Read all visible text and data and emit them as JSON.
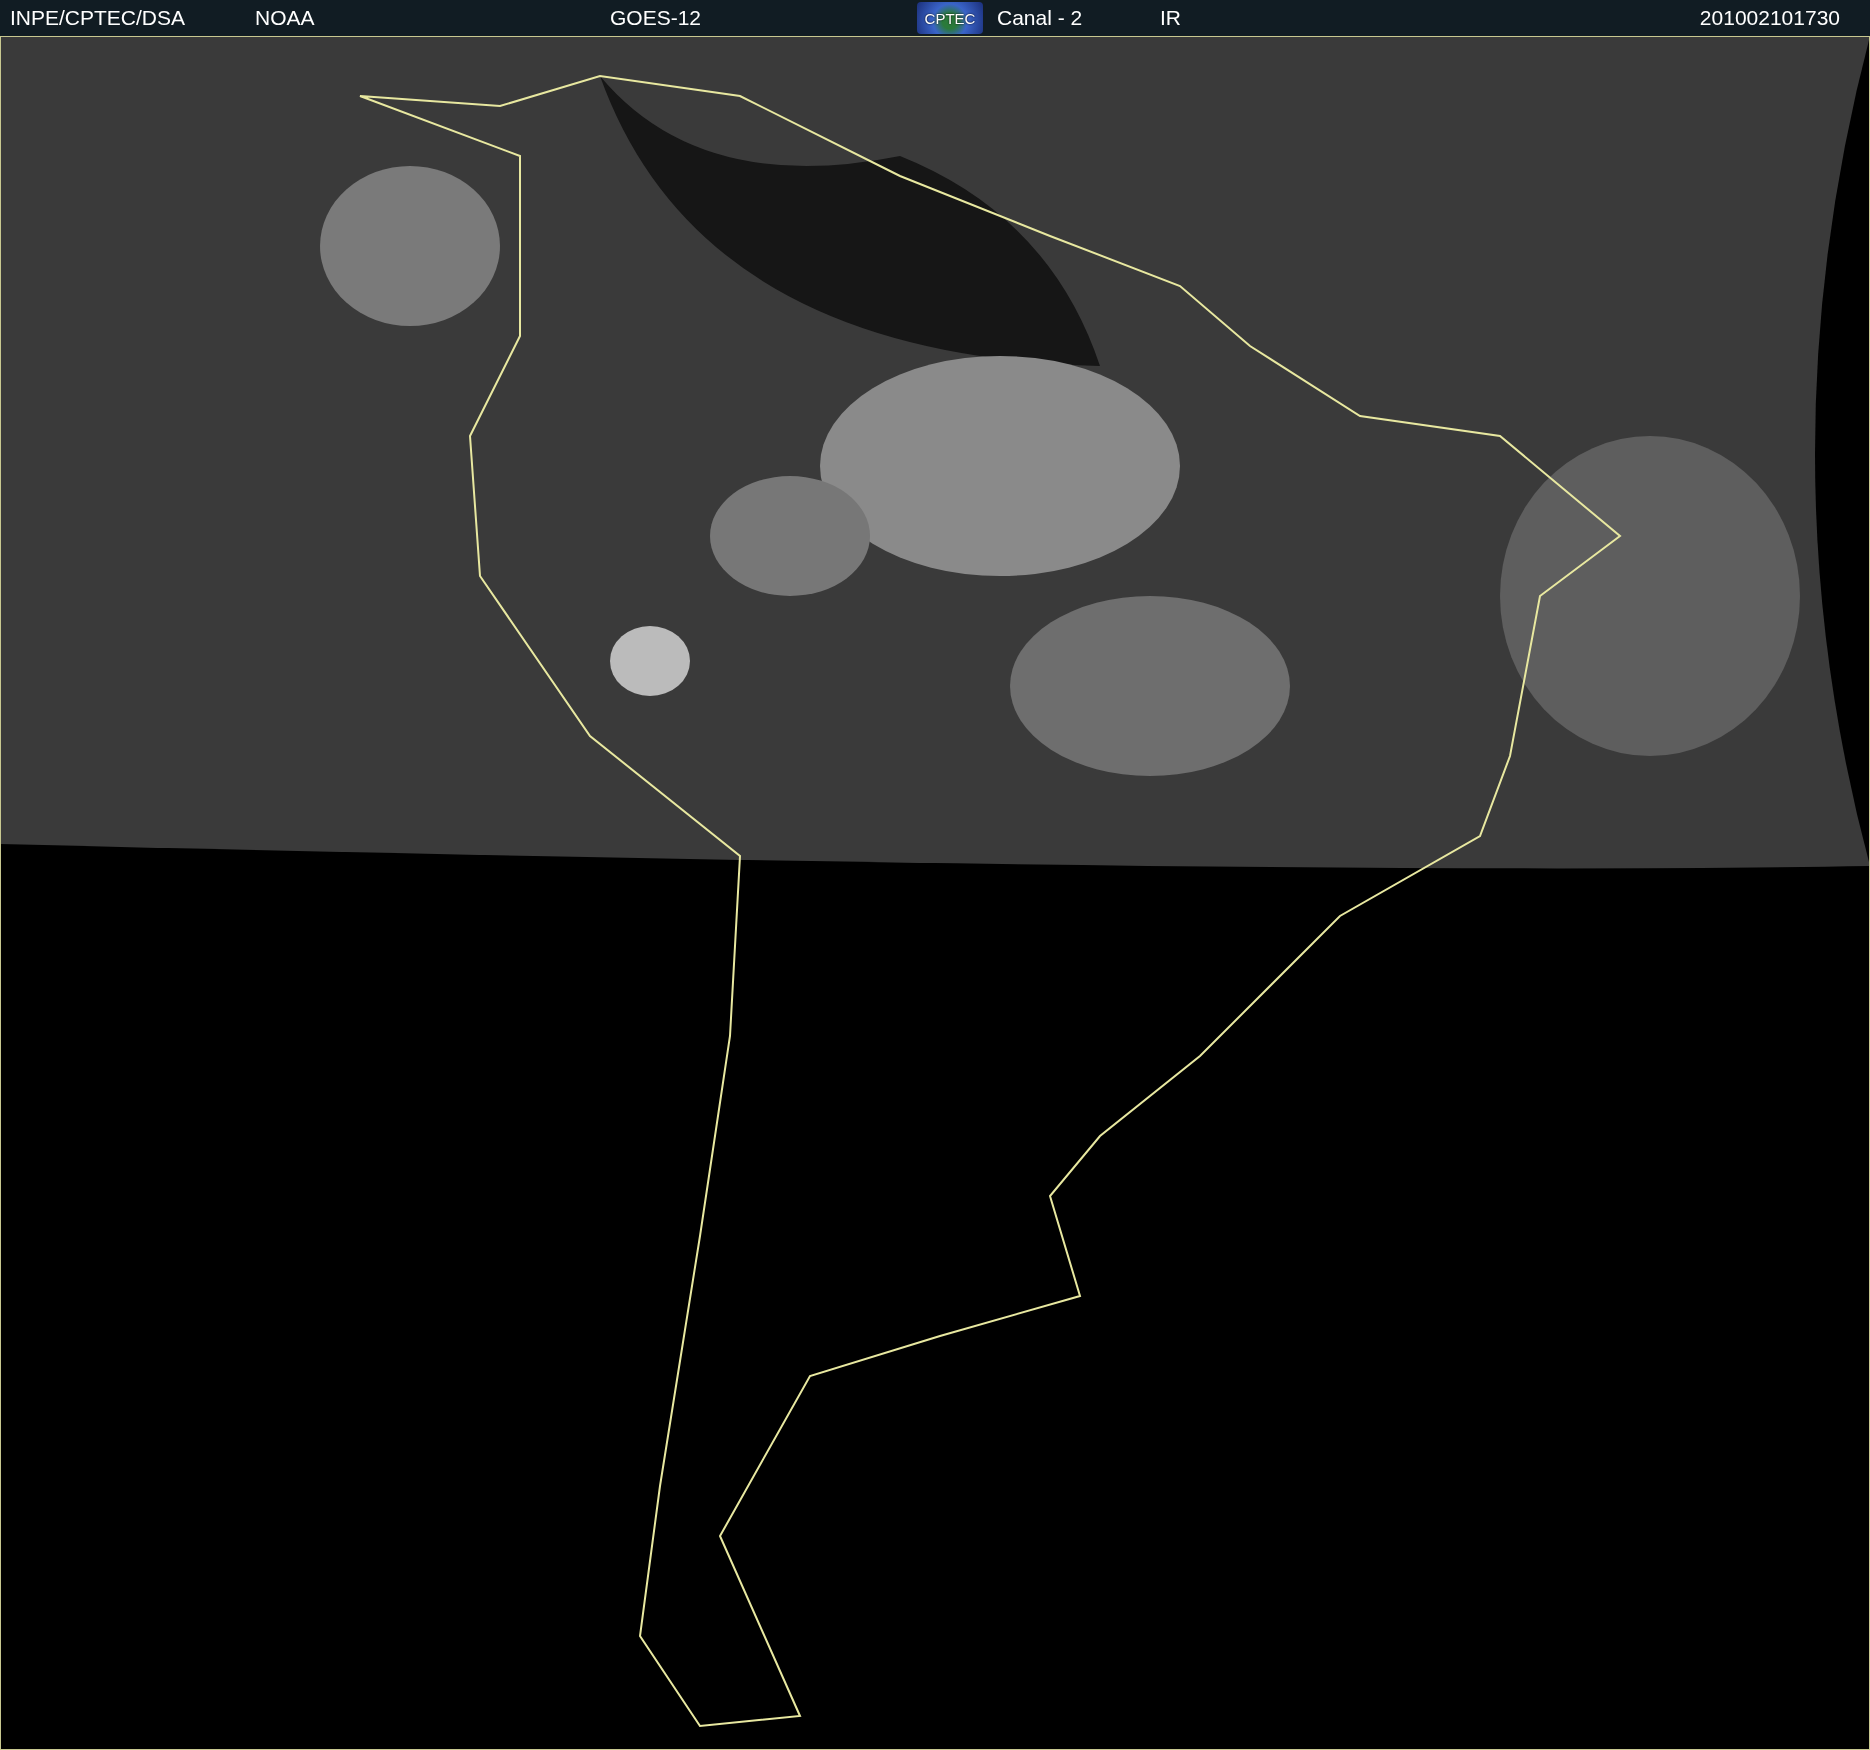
{
  "header": {
    "source": "INPE/CPTEC/DSA",
    "agency": "NOAA",
    "satellite": "GOES-12",
    "logo": "CPTEC",
    "channel": "Canal - 2",
    "band": "IR",
    "timestamp": "201002101730"
  }
}
